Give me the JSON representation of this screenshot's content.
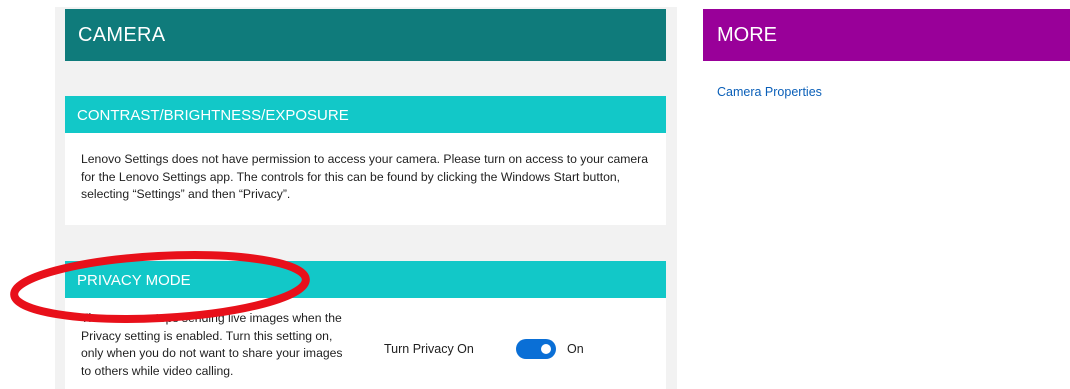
{
  "camera": {
    "title": "CAMERA"
  },
  "contrast": {
    "title": "CONTRAST/BRIGHTNESS/EXPOSURE",
    "message": "Lenovo Settings does not have permission to access your camera. Please turn on access to your camera for the Lenovo Settings app. The controls for this can be found by clicking the Windows Start button, selecting “Settings” and then “Privacy”."
  },
  "privacy": {
    "title": "PRIVACY MODE",
    "description": "The camera stops sending live images when the Privacy setting is enabled. Turn this setting on, only when you do not want to share your images to others while video calling.",
    "toggle_label": "Turn Privacy On",
    "toggle_state": "On",
    "toggle_on": true
  },
  "more": {
    "title": "MORE",
    "link": "Camera Properties"
  },
  "colors": {
    "camera_header": "#0f7b7b",
    "section_header": "#12c8c8",
    "more_header": "#990099",
    "toggle_on": "#0a6fd6",
    "link": "#0a5fb8",
    "annotation_circle": "#e8101a"
  }
}
